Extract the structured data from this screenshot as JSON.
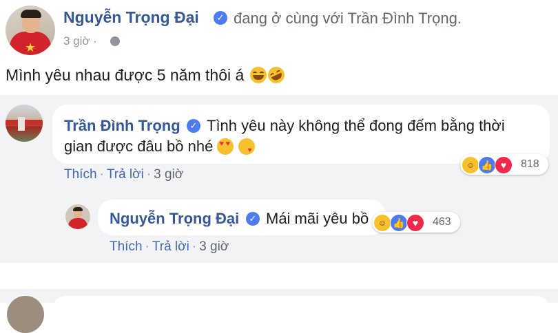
{
  "post": {
    "author": "Nguyễn Trọng Đại",
    "with_text": "đang ở cùng với Trần Đình Trọng.",
    "time": "3 giờ ·",
    "text": "Mình yêu nhau được 5 năm thôi á"
  },
  "comments": [
    {
      "author": "Trần Đình Trọng",
      "text_line1": "Tình yêu này không thể đong đếm bằng thời",
      "text_line2": "gian được đâu bồ nhé",
      "reactions_count": "818",
      "like_label": "Thích",
      "reply_label": "Trả lời",
      "time": "3 giờ"
    },
    {
      "author": "Nguyễn Trọng Đại",
      "text": "Mái mãi yêu bồ",
      "reactions_count": "463",
      "like_label": "Thích",
      "reply_label": "Trả lời",
      "time": "3 giờ"
    }
  ],
  "icons": {
    "verified": "verified-badge-icon",
    "globe": "globe-icon",
    "haha": "haha-reaction-icon",
    "like": "like-reaction-icon",
    "love": "love-reaction-icon"
  },
  "colors": {
    "name_link": "#365899",
    "secondary_text": "#606770",
    "comment_bg": "#f2f3f5",
    "verified": "#4c7cf0"
  }
}
